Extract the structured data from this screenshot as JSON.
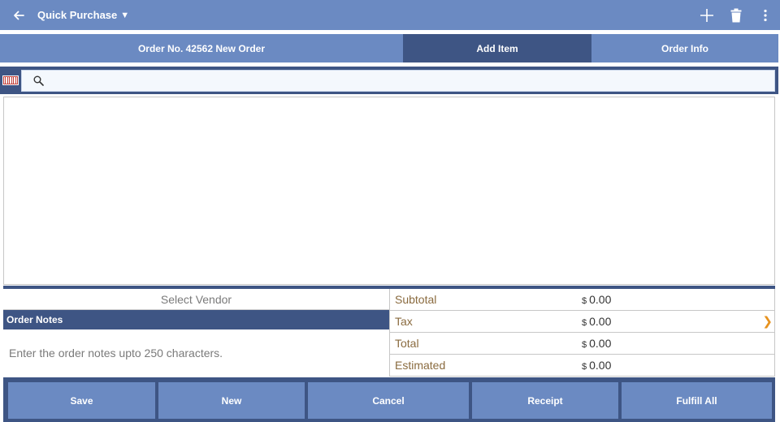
{
  "appbar": {
    "title": "Quick Purchase",
    "icons": {
      "back": "arrow-left-icon",
      "add": "plus-icon",
      "delete": "trash-icon",
      "more": "more-vert-icon"
    },
    "color": "#6b8ac2"
  },
  "tabs": [
    {
      "label": "Order No. 42562 New Order",
      "selected": false
    },
    {
      "label": "Add Item",
      "selected": true
    },
    {
      "label": "Order Info",
      "selected": false
    }
  ],
  "search": {
    "value": "",
    "placeholder": "",
    "icons": {
      "barcode": "barcode-icon",
      "search": "search-icon"
    }
  },
  "vendor": {
    "label": "Select Vendor"
  },
  "notes": {
    "header": "Order Notes",
    "placeholder": "Enter the order notes upto 250 characters."
  },
  "totals": [
    {
      "label": "Subtotal",
      "currency": "$",
      "amount": "0.00"
    },
    {
      "label": "Tax",
      "currency": "$",
      "amount": "0.00"
    },
    {
      "label": "Total",
      "currency": "$",
      "amount": "0.00"
    },
    {
      "label": "Estimated",
      "currency": "$",
      "amount": "0.00"
    }
  ],
  "actions": {
    "save": "Save",
    "new": "New",
    "cancel": "Cancel",
    "receipt": "Receipt",
    "fulfill_all": "Fulfill All"
  },
  "colors": {
    "primary": "#6b8ac2",
    "dark": "#3e5584",
    "accent": "#e7921e"
  }
}
